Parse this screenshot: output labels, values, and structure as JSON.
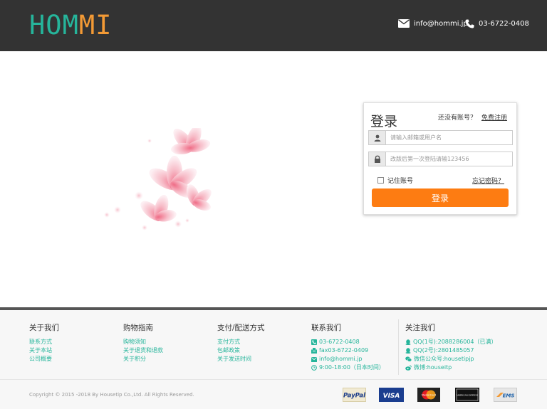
{
  "header": {
    "logo": {
      "h": "H",
      "o": "O",
      "m1": "M",
      "m2": "M",
      "i": "I"
    },
    "email": "info@hommi.jp",
    "phone": "03-6722-0408"
  },
  "login": {
    "title": "登录",
    "no_account": "还没有账号？",
    "register": "免费注册",
    "username_placeholder": "请输入邮箱或用户名",
    "password_placeholder": "改版后第一次登陆请输123456",
    "remember": "记住账号",
    "forgot": "忘记密码？",
    "submit": "登录"
  },
  "footer": {
    "columns": [
      {
        "title": "关于我们",
        "links": [
          "联系方式",
          "关于本站",
          "公司概要"
        ]
      },
      {
        "title": "购物指南",
        "links": [
          "购物须知",
          "关于退货和退款",
          "关于积分"
        ]
      },
      {
        "title": "支付/配送方式",
        "links": [
          "支付方式",
          "包邮政策",
          "关于发送时间"
        ]
      },
      {
        "title": "联系我们",
        "links": [
          "03-6722-0408",
          "fax03-6722-0409",
          "info@hommi.jp",
          "9:00-18:00（日本时间）"
        ]
      },
      {
        "title": "关注我们",
        "links": [
          "QQ(1号):2088286004（已满）",
          "QQ(2号):2801485057",
          "微信公众号:housetipjp",
          "微博:houseitp"
        ]
      }
    ],
    "copyright": "Copyright © 2015 -2018 By Housetip Co.,Ltd. All Rights Reserved.",
    "payments": {
      "paypal": "PayPal",
      "visa": "VISA",
      "mastercard": "MasterCard",
      "amex": "AMERICAN EXPRESS",
      "ems": "EMS"
    }
  },
  "colors": {
    "header_bg": "#333333",
    "accent_green": "#26b59b",
    "accent_orange": "#fd7c12"
  }
}
